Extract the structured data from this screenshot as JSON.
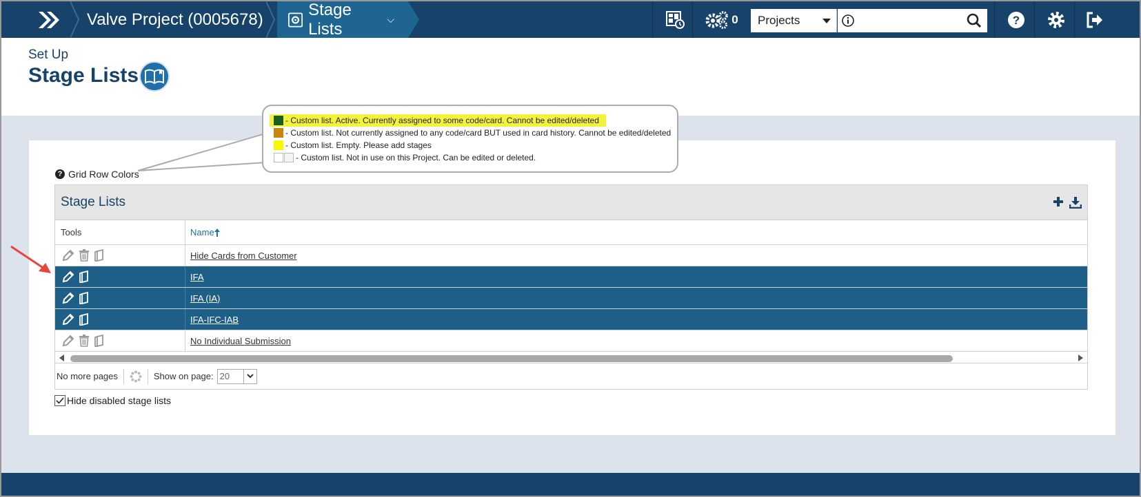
{
  "topbar": {
    "project_title": "Valve Project (0005678)",
    "current_section": "Stage Lists",
    "notification_count": "0",
    "scope_select": "Projects",
    "search_placeholder": ""
  },
  "header": {
    "subtitle": "Set Up",
    "title": "Stage Lists"
  },
  "legend": {
    "label": "Grid Row Colors",
    "items": [
      {
        "color": "#1b5e20",
        "text": "- Custom list. Active. Currently assigned to some code/card. Cannot be edited/deleted"
      },
      {
        "color": "#c8860a",
        "text": "- Custom list. Not currently assigned to any code/card BUT used in card history. Cannot be edited/deleted"
      },
      {
        "color": "#f7f700",
        "text": "- Custom list. Empty. Please add stages"
      },
      {
        "color": "#ffffff",
        "text": "- Custom list. Not in use on this Project. Can be edited or deleted."
      }
    ]
  },
  "grid": {
    "title": "Stage Lists",
    "col_tools": "Tools",
    "col_name": "Name",
    "rows": [
      {
        "name": "Hide Cards from Customer",
        "state": "inactive"
      },
      {
        "name": "IFA",
        "state": "active"
      },
      {
        "name": "IFA (IA)",
        "state": "active"
      },
      {
        "name": "IFA-IFC-IAB",
        "state": "active"
      },
      {
        "name": "No Individual Submission",
        "state": "inactive"
      }
    ],
    "pager_text": "No more pages",
    "show_on_page_label": "Show on page:",
    "page_size": "20"
  },
  "options": {
    "hide_disabled_label": "Hide disabled stage lists",
    "hide_disabled_checked": true
  },
  "colors": {
    "navy": "#17436b",
    "active_row": "#1e5f88",
    "accent": "#1f6fa8"
  }
}
